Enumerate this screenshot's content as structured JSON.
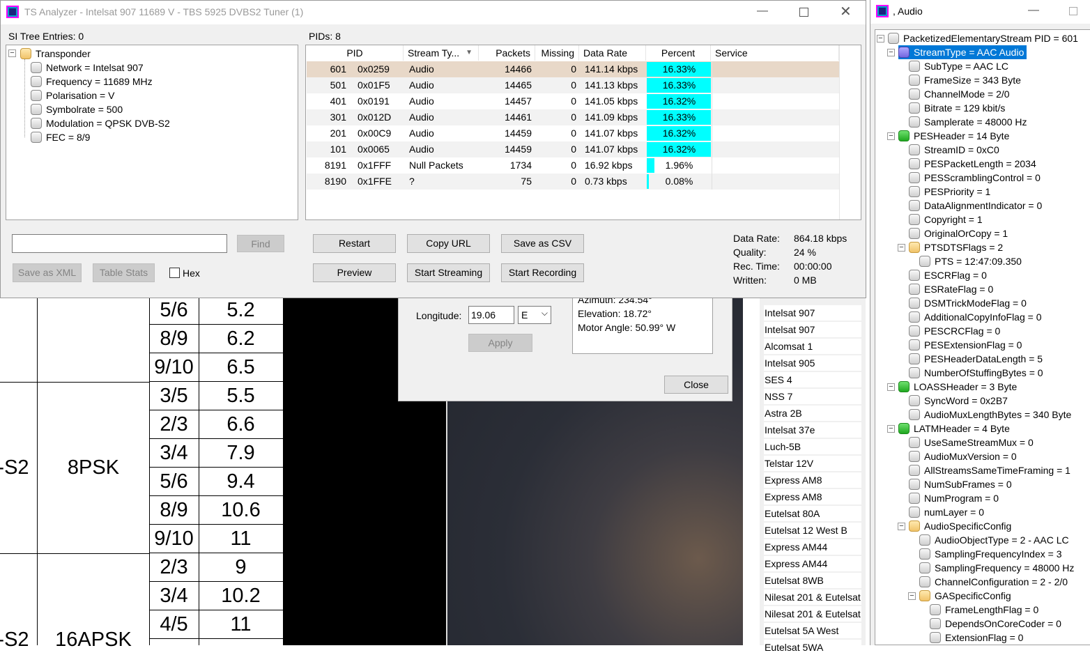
{
  "main_window": {
    "title": "TS Analyzer - Intelsat 907 11689 V - TBS 5925 DVBS2 Tuner (1)",
    "si_tree_label": "SI Tree Entries: 0",
    "pids_label": "PIDs: 8",
    "si_tree": {
      "root": "Transponder",
      "children": [
        "Network = Intelsat 907",
        "Frequency = 11689 MHz",
        "Polarisation = V",
        "Symbolrate = 500",
        "Modulation = QPSK DVB-S2",
        "FEC = 8/9"
      ]
    },
    "pid_table": {
      "headers": [
        "PID",
        "Stream Ty...",
        "Packets",
        "Missing",
        "Data Rate",
        "Percent",
        "Service"
      ],
      "rows": [
        {
          "pid": "601",
          "hex": "0x0259",
          "type": "Audio",
          "packets": "14466",
          "missing": "0",
          "rate": "141.14 kbps",
          "percent": "16.33%",
          "fill": 0.1633
        },
        {
          "pid": "501",
          "hex": "0x01F5",
          "type": "Audio",
          "packets": "14465",
          "missing": "0",
          "rate": "141.13 kbps",
          "percent": "16.33%",
          "fill": 0.1633
        },
        {
          "pid": "401",
          "hex": "0x0191",
          "type": "Audio",
          "packets": "14457",
          "missing": "0",
          "rate": "141.05 kbps",
          "percent": "16.32%",
          "fill": 0.1632
        },
        {
          "pid": "301",
          "hex": "0x012D",
          "type": "Audio",
          "packets": "14461",
          "missing": "0",
          "rate": "141.09 kbps",
          "percent": "16.33%",
          "fill": 0.1633
        },
        {
          "pid": "201",
          "hex": "0x00C9",
          "type": "Audio",
          "packets": "14459",
          "missing": "0",
          "rate": "141.07 kbps",
          "percent": "16.32%",
          "fill": 0.1632
        },
        {
          "pid": "101",
          "hex": "0x0065",
          "type": "Audio",
          "packets": "14459",
          "missing": "0",
          "rate": "141.07 kbps",
          "percent": "16.32%",
          "fill": 0.1632
        },
        {
          "pid": "8191",
          "hex": "0x1FFF",
          "type": "Null Packets",
          "packets": "1734",
          "missing": "0",
          "rate": "16.92 kbps",
          "percent": "1.96%",
          "fill": 0.0196
        },
        {
          "pid": "8190",
          "hex": "0x1FFE",
          "type": "?",
          "packets": "75",
          "missing": "0",
          "rate": "0.73 kbps",
          "percent": "0.08%",
          "fill": 0.0008
        }
      ]
    },
    "buttons": {
      "find": "Find",
      "save_xml": "Save as XML",
      "table_stats": "Table Stats",
      "hex": "Hex",
      "restart": "Restart",
      "copy_url": "Copy URL",
      "save_csv": "Save as CSV",
      "preview": "Preview",
      "start_streaming": "Start Streaming",
      "start_recording": "Start Recording"
    },
    "search_value": "",
    "stats": {
      "data_rate_label": "Data Rate:",
      "data_rate": "864.18 kbps",
      "quality_label": "Quality:",
      "quality": "24 %",
      "rec_time_label": "Rec. Time:",
      "rec_time": "00:00:00",
      "written_label": "Written:",
      "written": "0 MB"
    }
  },
  "sat_dialog": {
    "longitude_label": "Longitude:",
    "longitude_value": "19.06",
    "direction": "E",
    "apply": "Apply",
    "azimuth": "Azimuth: 234.54°",
    "elevation": "Elevation: 18.72°",
    "motor_angle": "Motor Angle: 50.99° W",
    "close": "Close"
  },
  "sat_list": [
    "Intelsat 907",
    "Intelsat 907",
    "Alcomsat 1",
    "Intelsat 905",
    "SES 4",
    "NSS 7",
    "Astra 2B",
    "Intelsat 37e",
    "Luch-5B",
    "Telstar 12V",
    "Express AM8",
    "Express AM8",
    "Eutelsat 80A",
    "Eutelsat 12 West B",
    "Express AM44",
    "Express AM44",
    "Eutelsat 8WB",
    "Nilesat 201 & Eutelsat",
    "Nilesat 201 & Eutelsat",
    "Eutelsat 5A West",
    "Eutelsat 5WA"
  ],
  "bg_table": {
    "rows": [
      [
        "5/6",
        "5.2"
      ],
      [
        "8/9",
        "6.2"
      ],
      [
        "9/10",
        "6.5"
      ],
      [
        "3/5",
        "5.5"
      ],
      [
        "2/3",
        "6.6"
      ],
      [
        "3/4",
        "7.9"
      ],
      [
        "5/6",
        "9.4"
      ],
      [
        "8/9",
        "10.6"
      ],
      [
        "9/10",
        "11"
      ],
      [
        "2/3",
        "9"
      ],
      [
        "3/4",
        "10.2"
      ],
      [
        "4/5",
        "11"
      ]
    ],
    "mod_8psk": "8PSK",
    "mod_16apsk": "16APSK",
    "std_a": "-S2",
    "std_b": "-S2"
  },
  "audio_window": {
    "title": ", Audio",
    "tree": [
      {
        "depth": 0,
        "icon": "gray",
        "exp": "-",
        "text": "PacketizedElementaryStream PID = 601"
      },
      {
        "depth": 1,
        "icon": "purple",
        "exp": "-",
        "text": "StreamType = AAC Audio",
        "selected": true
      },
      {
        "depth": 2,
        "icon": "gray",
        "text": "SubType = AAC LC"
      },
      {
        "depth": 2,
        "icon": "gray",
        "text": "FrameSize = 343 Byte"
      },
      {
        "depth": 2,
        "icon": "gray",
        "text": "ChannelMode = 2/0"
      },
      {
        "depth": 2,
        "icon": "gray",
        "text": "Bitrate = 129 kbit/s"
      },
      {
        "depth": 2,
        "icon": "gray",
        "text": "Samplerate = 48000 Hz"
      },
      {
        "depth": 1,
        "icon": "green",
        "exp": "-",
        "text": "PESHeader = 14 Byte"
      },
      {
        "depth": 2,
        "icon": "gray",
        "text": "StreamID = 0xC0"
      },
      {
        "depth": 2,
        "icon": "gray",
        "text": "PESPacketLength = 2034"
      },
      {
        "depth": 2,
        "icon": "gray",
        "text": "PESScramblingControl = 0"
      },
      {
        "depth": 2,
        "icon": "gray",
        "text": "PESPriority = 1"
      },
      {
        "depth": 2,
        "icon": "gray",
        "text": "DataAlignmentIndicator = 0"
      },
      {
        "depth": 2,
        "icon": "gray",
        "text": "Copyright = 1"
      },
      {
        "depth": 2,
        "icon": "gray",
        "text": "OriginalOrCopy = 1"
      },
      {
        "depth": 2,
        "icon": "orange",
        "exp": "-",
        "text": "PTSDTSFlags = 2"
      },
      {
        "depth": 3,
        "icon": "gray",
        "text": "PTS = 12:47:09.350"
      },
      {
        "depth": 2,
        "icon": "gray",
        "text": "ESCRFlag = 0"
      },
      {
        "depth": 2,
        "icon": "gray",
        "text": "ESRateFlag = 0"
      },
      {
        "depth": 2,
        "icon": "gray",
        "text": "DSMTrickModeFlag = 0"
      },
      {
        "depth": 2,
        "icon": "gray",
        "text": "AdditionalCopyInfoFlag = 0"
      },
      {
        "depth": 2,
        "icon": "gray",
        "text": "PESCRCFlag = 0"
      },
      {
        "depth": 2,
        "icon": "gray",
        "text": "PESExtensionFlag = 0"
      },
      {
        "depth": 2,
        "icon": "gray",
        "text": "PESHeaderDataLength = 5"
      },
      {
        "depth": 2,
        "icon": "gray",
        "text": "NumberOfStuffingBytes = 0"
      },
      {
        "depth": 1,
        "icon": "green",
        "exp": "-",
        "text": "LOASSHeader = 3 Byte"
      },
      {
        "depth": 2,
        "icon": "gray",
        "text": "SyncWord = 0x2B7"
      },
      {
        "depth": 2,
        "icon": "gray",
        "text": "AudioMuxLengthBytes = 340 Byte"
      },
      {
        "depth": 1,
        "icon": "green",
        "exp": "-",
        "text": "LATMHeader = 4 Byte"
      },
      {
        "depth": 2,
        "icon": "gray",
        "text": "UseSameStreamMux = 0"
      },
      {
        "depth": 2,
        "icon": "gray",
        "text": "AudioMuxVersion = 0"
      },
      {
        "depth": 2,
        "icon": "gray",
        "text": "AllStreamsSameTimeFraming = 1"
      },
      {
        "depth": 2,
        "icon": "gray",
        "text": "NumSubFrames = 0"
      },
      {
        "depth": 2,
        "icon": "gray",
        "text": "NumProgram = 0"
      },
      {
        "depth": 2,
        "icon": "gray",
        "text": "numLayer = 0"
      },
      {
        "depth": 2,
        "icon": "orange",
        "exp": "-",
        "text": "AudioSpecificConfig"
      },
      {
        "depth": 3,
        "icon": "gray",
        "text": "AudioObjectType = 2 - AAC LC"
      },
      {
        "depth": 3,
        "icon": "gray",
        "text": "SamplingFrequencyIndex = 3"
      },
      {
        "depth": 3,
        "icon": "gray",
        "text": "SamplingFrequency = 48000 Hz"
      },
      {
        "depth": 3,
        "icon": "gray",
        "text": "ChannelConfiguration = 2 - 2/0"
      },
      {
        "depth": 3,
        "icon": "orange",
        "exp": "-",
        "text": "GASpecificConfig"
      },
      {
        "depth": 4,
        "icon": "gray",
        "text": "FrameLengthFlag = 0"
      },
      {
        "depth": 4,
        "icon": "gray",
        "text": "DependsOnCoreCoder = 0"
      },
      {
        "depth": 4,
        "icon": "gray",
        "text": "ExtensionFlag = 0"
      }
    ]
  },
  "colors": {
    "accent": "#0078d7",
    "percent_bar": "#00ffff",
    "selected_row": "#e8d8c8"
  }
}
